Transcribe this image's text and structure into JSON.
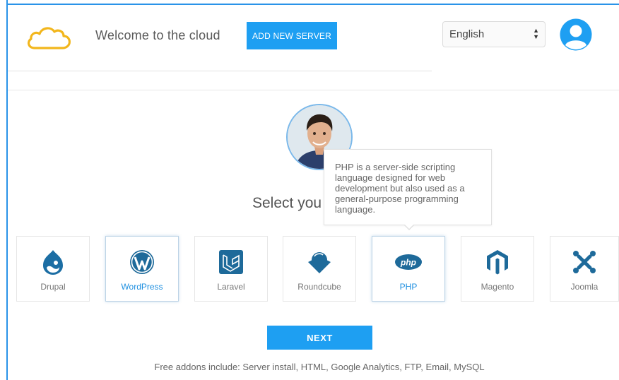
{
  "header": {
    "welcome_text": "Welcome to the cloud",
    "add_server_label": "ADD NEW SERVER",
    "language_selected": "English",
    "arrows": "▲\n▼"
  },
  "main": {
    "select_title": "Select you",
    "tooltip_text": "PHP is a server-side scripting language designed for web development but also used as a general-purpose programming language.",
    "apps": [
      {
        "label": "Drupal",
        "icon": "drupal-icon",
        "color": "#1c6ea4"
      },
      {
        "label": "WordPress",
        "icon": "wordpress-icon",
        "color": "#1e6a9a"
      },
      {
        "label": "Laravel",
        "icon": "laravel-icon",
        "color": "#1e6a9a"
      },
      {
        "label": "Roundcube",
        "icon": "roundcube-icon",
        "color": "#1e6a9a"
      },
      {
        "label": "PHP",
        "icon": "php-icon",
        "color": "#1e6a9a"
      },
      {
        "label": "Magento",
        "icon": "magento-icon",
        "color": "#1e6a9a"
      },
      {
        "label": "Joomla",
        "icon": "joomla-icon",
        "color": "#1e6a9a"
      }
    ],
    "next_label": "NEXT",
    "addons_text": "Free addons include: Server install, HTML, Google Analytics, FTP, Email, MySQL"
  },
  "colors": {
    "accent": "#1e9ff2",
    "frame": "#2a93e8",
    "logo": "#f2b61c",
    "icon": "#1e6a9a"
  }
}
